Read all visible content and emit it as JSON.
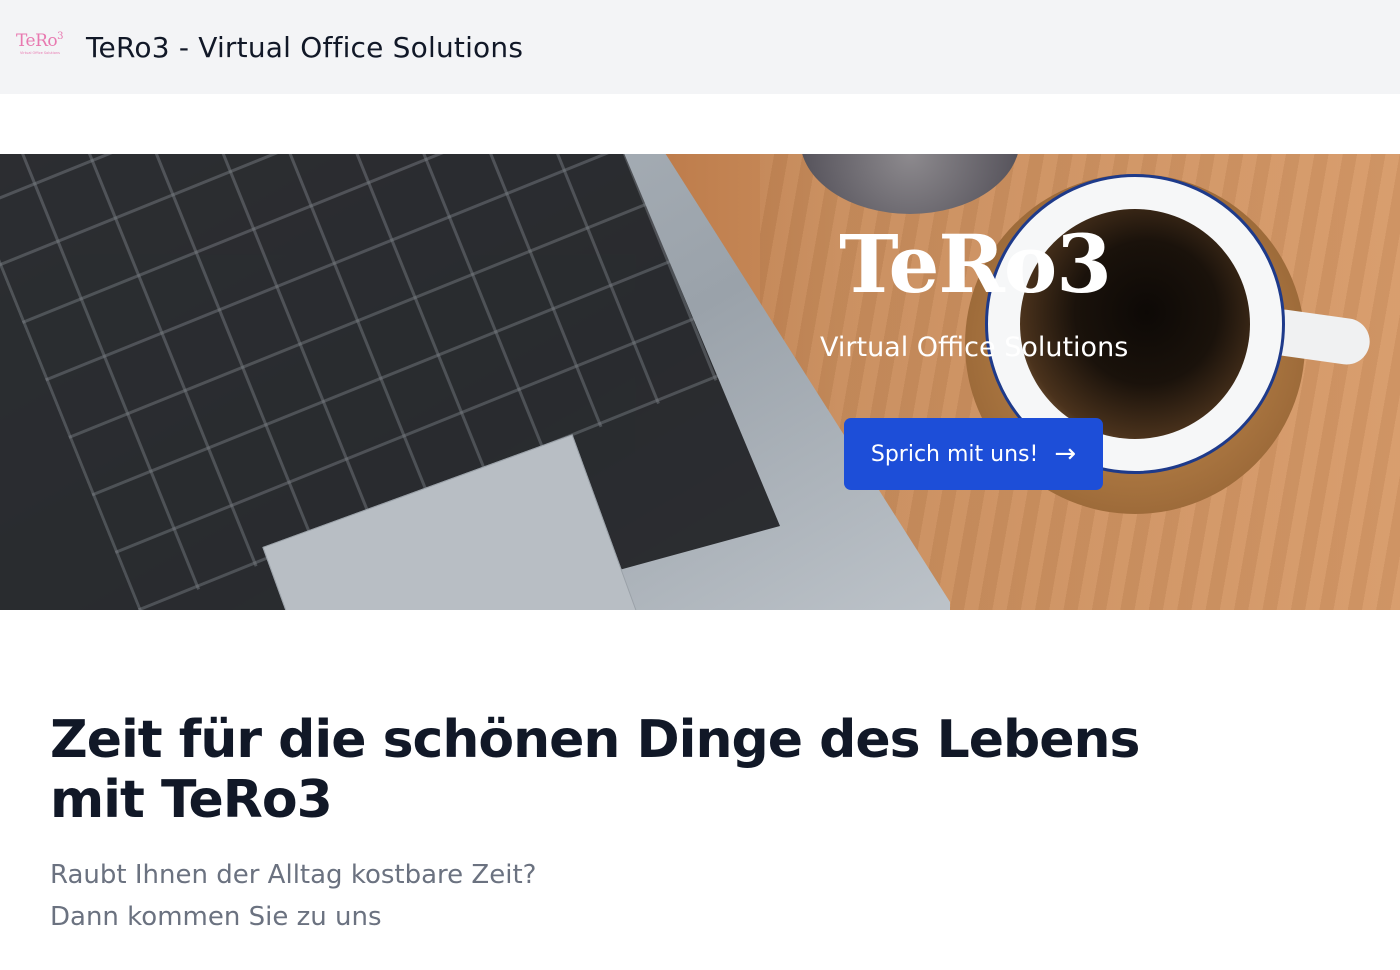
{
  "header": {
    "logo": {
      "main": "TeRo",
      "sup": "3",
      "sub": "Virtual Office Solutions"
    },
    "title": "TeRo3 - Virtual Office Solutions"
  },
  "hero": {
    "title": "TeRo3",
    "subtitle": "Virtual Office Solutions",
    "cta_label": "Sprich mit uns!",
    "cta_icon": "arrow-right-icon"
  },
  "content": {
    "headline": "Zeit für die schönen Dinge des Lebens mit TeRo3",
    "lead_line1": "Raubt Ihnen der Alltag kostbare Zeit?",
    "lead_line2": "Dann kommen Sie zu uns"
  },
  "colors": {
    "header_bg": "#f3f4f6",
    "cta_bg": "#1d4ed8",
    "logo": "#e879b0",
    "lead_text": "#6b7280"
  }
}
